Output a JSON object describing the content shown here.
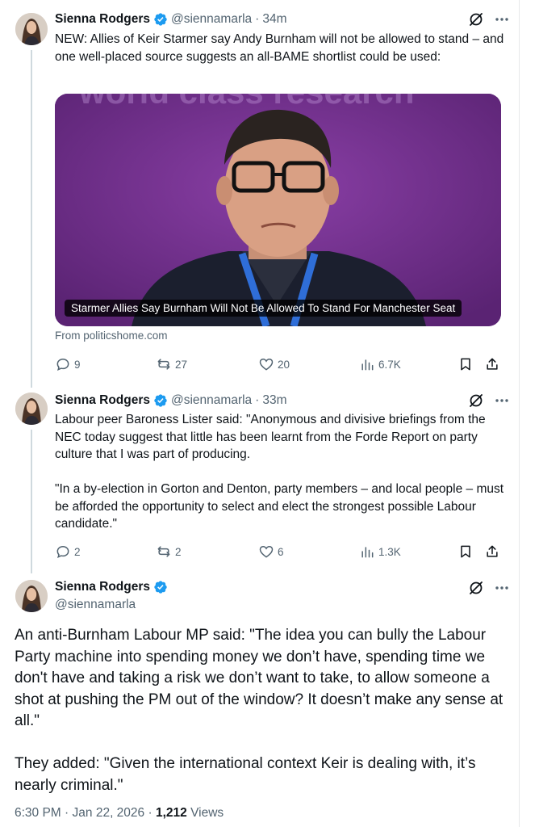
{
  "colors": {
    "accent": "#1d9bf0",
    "text": "#0f1419",
    "muted": "#536471",
    "border": "#cfd9de"
  },
  "tweets": [
    {
      "author": "Sienna Rodgers",
      "handle": "@siennamarla",
      "separator": "·",
      "time": "34m",
      "text": "NEW: Allies of Keir Starmer say Andy Burnham will not be allowed to stand – and one well-placed source suggests an all-BAME shortlist could be used:",
      "card": {
        "caption": "Starmer Allies Say Burnham Will Not Be Allowed To Stand For Manchester Seat",
        "background_text": "world class research",
        "source": "From politicshome.com"
      },
      "stats": {
        "replies": "9",
        "reposts": "27",
        "likes": "20",
        "views": "6.7K"
      }
    },
    {
      "author": "Sienna Rodgers",
      "handle": "@siennamarla",
      "separator": "·",
      "time": "33m",
      "text": "Labour peer Baroness Lister said: \"Anonymous and divisive briefings from the NEC today suggest that little has been learnt from the Forde Report on party culture that I was part of producing.\n\n\"In a by-election in Gorton and Denton, party members – and local people – must be afforded the opportunity to select and elect the strongest possible Labour candidate.\"",
      "stats": {
        "replies": "2",
        "reposts": "2",
        "likes": "6",
        "views": "1.3K"
      }
    }
  ],
  "main_tweet": {
    "author": "Sienna Rodgers",
    "handle": "@siennamarla",
    "text": "An anti-Burnham Labour MP said: \"The idea you can bully the Labour Party machine into spending money we don’t have, spending time we don't have and taking a risk we don’t want to take, to allow someone a shot at pushing the PM out of the window? It doesn’t make any sense at all.\"\n\nThey added: \"Given the international context Keir is dealing with, it’s nearly criminal.\"",
    "time": "6:30 PM",
    "separator": "·",
    "date": "Jan 22, 2026",
    "views_count": "1,212",
    "views_label": "Views"
  }
}
